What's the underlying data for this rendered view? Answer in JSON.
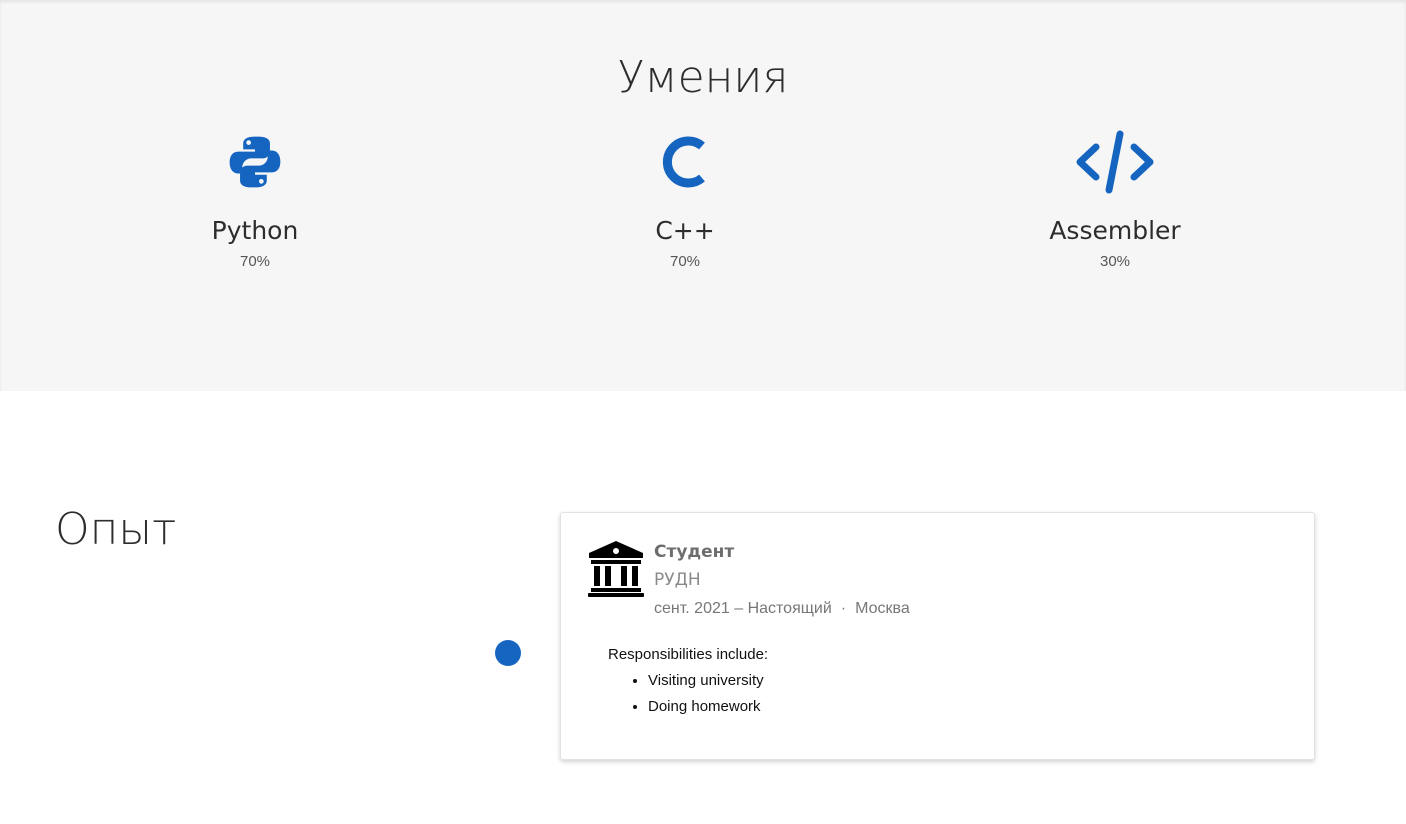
{
  "skills": {
    "title": "Умения",
    "accent_color": "#1565c0",
    "items": [
      {
        "name": "Python",
        "level": "70%",
        "icon": "python-icon"
      },
      {
        "name": "C++",
        "level": "70%",
        "icon": "c-language-icon"
      },
      {
        "name": "Assembler",
        "level": "30%",
        "icon": "code-icon"
      }
    ]
  },
  "experience": {
    "title": "Опыт",
    "items": [
      {
        "icon": "university-icon",
        "role": "Студент",
        "organization": "РУДН",
        "period": "сент. 2021 – Настоящий",
        "separator": "·",
        "location": "Москва",
        "description_intro": "Responsibilities include:",
        "bullets": [
          "Visiting university",
          "Doing homework"
        ]
      }
    ]
  }
}
